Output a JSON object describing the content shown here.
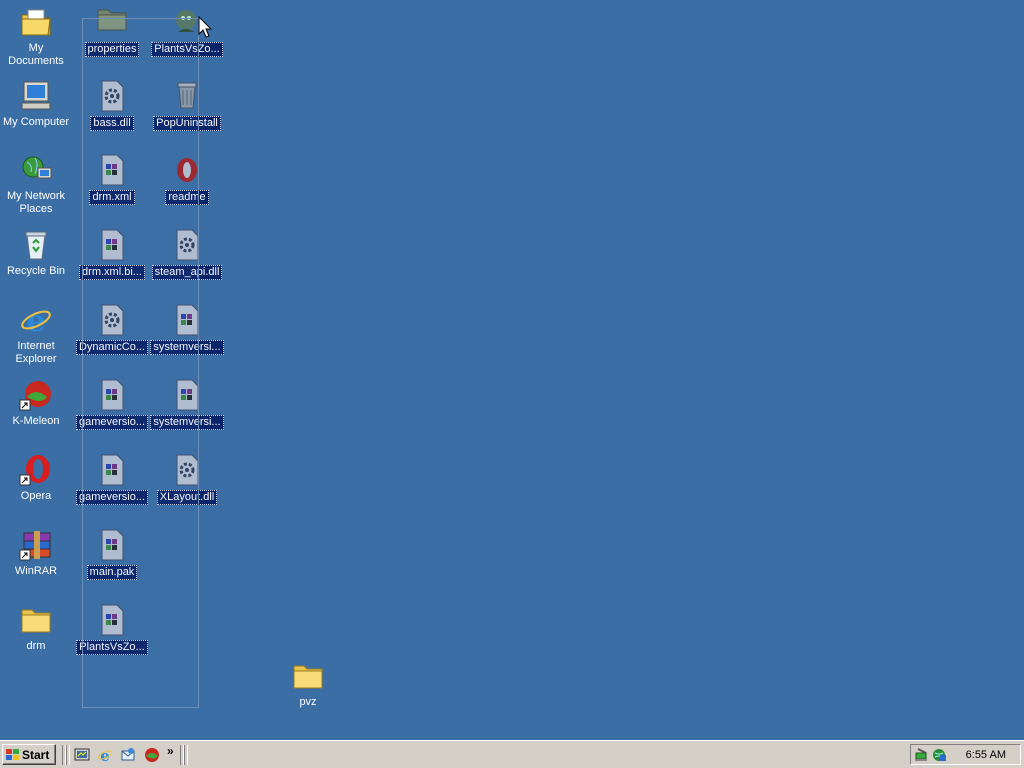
{
  "desktop": {
    "left_icons": [
      {
        "label": "My Documents",
        "icon": "my-documents-icon"
      },
      {
        "label": "My Computer",
        "icon": "my-computer-icon"
      },
      {
        "label": "My Network Places",
        "icon": "network-places-icon"
      },
      {
        "label": "Recycle Bin",
        "icon": "recycle-bin-icon"
      },
      {
        "label": "Internet Explorer",
        "icon": "internet-explorer-icon"
      },
      {
        "label": "K-Meleon",
        "icon": "k-meleon-icon"
      },
      {
        "label": "Opera",
        "icon": "opera-icon"
      },
      {
        "label": "WinRAR",
        "icon": "winrar-icon"
      },
      {
        "label": "drm",
        "icon": "folder-icon"
      }
    ],
    "col2_icons": [
      {
        "label": "properties",
        "icon": "folder-icon"
      },
      {
        "label": "bass.dll",
        "icon": "dll-gear-icon"
      },
      {
        "label": "drm.xml",
        "icon": "generic-file-icon"
      },
      {
        "label": "drm.xml.bi...",
        "icon": "generic-file-icon"
      },
      {
        "label": "DynamicCo...",
        "icon": "dll-gear-icon"
      },
      {
        "label": "gameversio...",
        "icon": "generic-file-icon"
      },
      {
        "label": "gameversio...",
        "icon": "generic-file-icon"
      },
      {
        "label": "main.pak",
        "icon": "generic-file-icon"
      },
      {
        "label": "PlantsVsZo...",
        "icon": "generic-file-icon"
      }
    ],
    "col3_icons": [
      {
        "label": "PlantsVsZo...",
        "icon": "plants-vs-zombies-icon"
      },
      {
        "label": "PopUninstall",
        "icon": "uninstall-icon"
      },
      {
        "label": "readme",
        "icon": "opera-document-icon"
      },
      {
        "label": "steam_api.dll",
        "icon": "dll-gear-icon"
      },
      {
        "label": "systemversi...",
        "icon": "generic-file-icon"
      },
      {
        "label": "systemversi...",
        "icon": "generic-file-icon"
      },
      {
        "label": "XLayout.dll",
        "icon": "dll-gear-icon"
      }
    ],
    "pvz_folder": {
      "label": "pvz",
      "icon": "folder-icon"
    }
  },
  "taskbar": {
    "start_label": "Start",
    "quick_launch": [
      "show-desktop-icon",
      "internet-explorer-icon",
      "outlook-express-icon",
      "k-meleon-icon"
    ],
    "chevron": "»",
    "tray_icons": [
      "safely-remove-hardware-icon",
      "network-icon"
    ],
    "clock": "6:55 AM"
  },
  "colors": {
    "desktop": "#3a6ea5",
    "selection": "#0a246a",
    "taskbar": "#d4d0c8"
  }
}
